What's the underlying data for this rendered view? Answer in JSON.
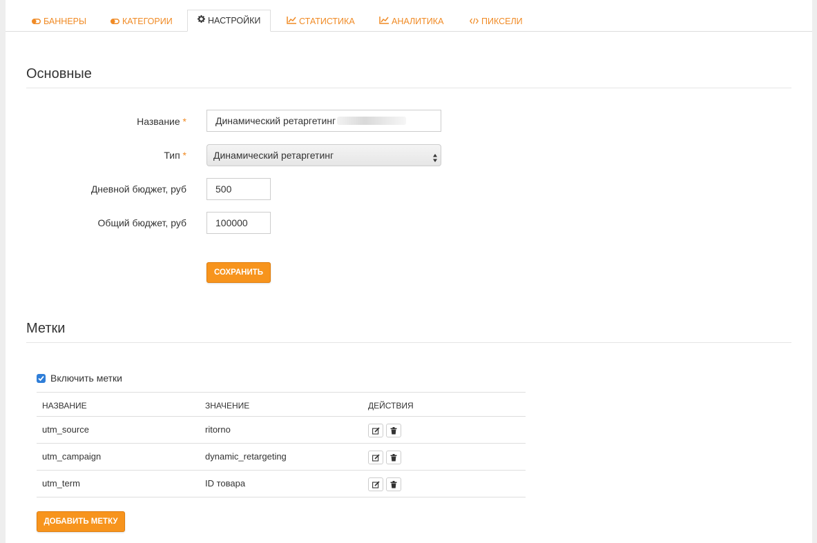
{
  "tabs": [
    {
      "label": "Баннеры",
      "icon": "toggle-icon"
    },
    {
      "label": "Категории",
      "icon": "toggle-icon"
    },
    {
      "label": "Настройки",
      "icon": "gear-icon",
      "active": true
    },
    {
      "label": "Статистика",
      "icon": "line-chart-icon"
    },
    {
      "label": "Аналитика",
      "icon": "area-chart-icon"
    },
    {
      "label": "Пиксели",
      "icon": "code-icon"
    }
  ],
  "main": {
    "title": "Основные",
    "fields": {
      "name_label": "Название",
      "name_value": "Динамический ретаргетинг",
      "type_label": "Тип",
      "type_value": "Динамический ретаргетинг",
      "daily_label": "Дневной бюджет, руб",
      "daily_value": "500",
      "total_label": "Общий бюджет, руб",
      "total_value": "100000"
    },
    "required_mark": "*",
    "save_label": "Сохранить"
  },
  "labels": {
    "title": "Метки",
    "enable_label": "Включить метки",
    "enabled": true,
    "columns": [
      "Название",
      "Значение",
      "Действия"
    ],
    "rows": [
      {
        "name": "utm_source",
        "value": "ritorno"
      },
      {
        "name": "utm_campaign",
        "value": "dynamic_retargeting"
      },
      {
        "name": "utm_term",
        "value": "ID товара"
      }
    ],
    "add_label": "Добавить метку"
  },
  "colors": {
    "accent": "#f08a24",
    "button": "#f7941d",
    "checkbox": "#2f7ed8"
  }
}
